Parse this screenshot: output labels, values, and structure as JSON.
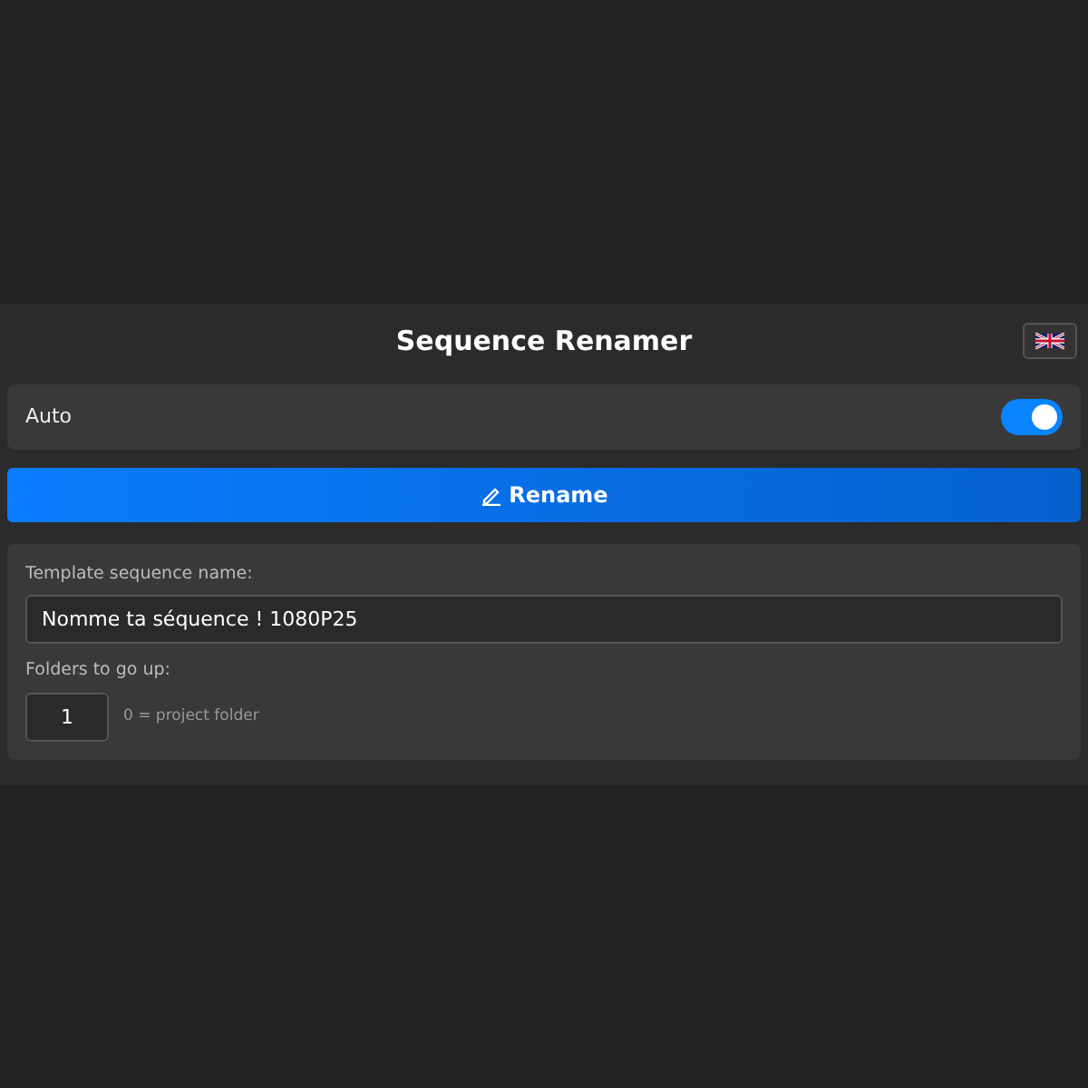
{
  "header": {
    "title": "Sequence Renamer"
  },
  "auto": {
    "label": "Auto",
    "on": true
  },
  "rename_button": {
    "label": "Rename"
  },
  "template": {
    "label": "Template sequence name:",
    "value": "Nomme ta séquence ! 1080P25"
  },
  "folders": {
    "label": "Folders to go up:",
    "value": "1",
    "hint": "0 = project folder"
  }
}
